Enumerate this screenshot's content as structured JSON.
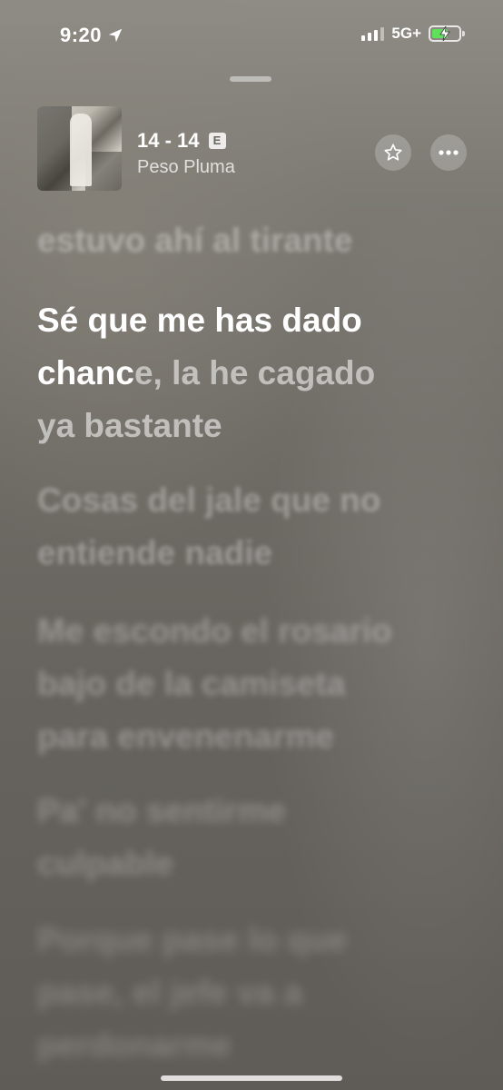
{
  "status_bar": {
    "time": "9:20",
    "network": "5G+",
    "battery_charging": true,
    "battery_fill": 0.6,
    "battery_color": "#5fe05a",
    "signal_bars_active": 3,
    "signal_bars_total": 4,
    "location_icon": "location-arrow-icon"
  },
  "now_playing": {
    "title": "14 - 14",
    "explicit_label": "E",
    "artist": "Peso Pluma",
    "artwork_icon": "album-artwork",
    "favorite_icon": "star-icon",
    "more_icon": "ellipsis-icon"
  },
  "lyrics": {
    "previous": "estuvo ahí al tirante",
    "current": {
      "sung_part": "Sé que me has dado chanc",
      "unsung_part": "e, la he cagado ya bastante",
      "line1_sung": "Sé que me has dado",
      "line2_sung": "chanc",
      "line2_unsung": "e, la he cagado",
      "line3_unsung": "ya bastante"
    },
    "upcoming": [
      {
        "line1": "Cosas del jale que no",
        "line2": "entiende nadie",
        "line3": ""
      },
      {
        "line1": "Me escondo el rosario",
        "line2": "bajo de la camiseta",
        "line3": "para envenenarme"
      },
      {
        "line1": "Pa' no sentirme",
        "line2": "culpable",
        "line3": ""
      },
      {
        "line1": "Porque pase lo que",
        "line2": "pase, el jefe va a",
        "line3": "perdonarme"
      }
    ]
  },
  "colors": {
    "background_top": "#8f8c86",
    "background_bottom": "#5f5c57",
    "text_primary": "#ffffff"
  }
}
